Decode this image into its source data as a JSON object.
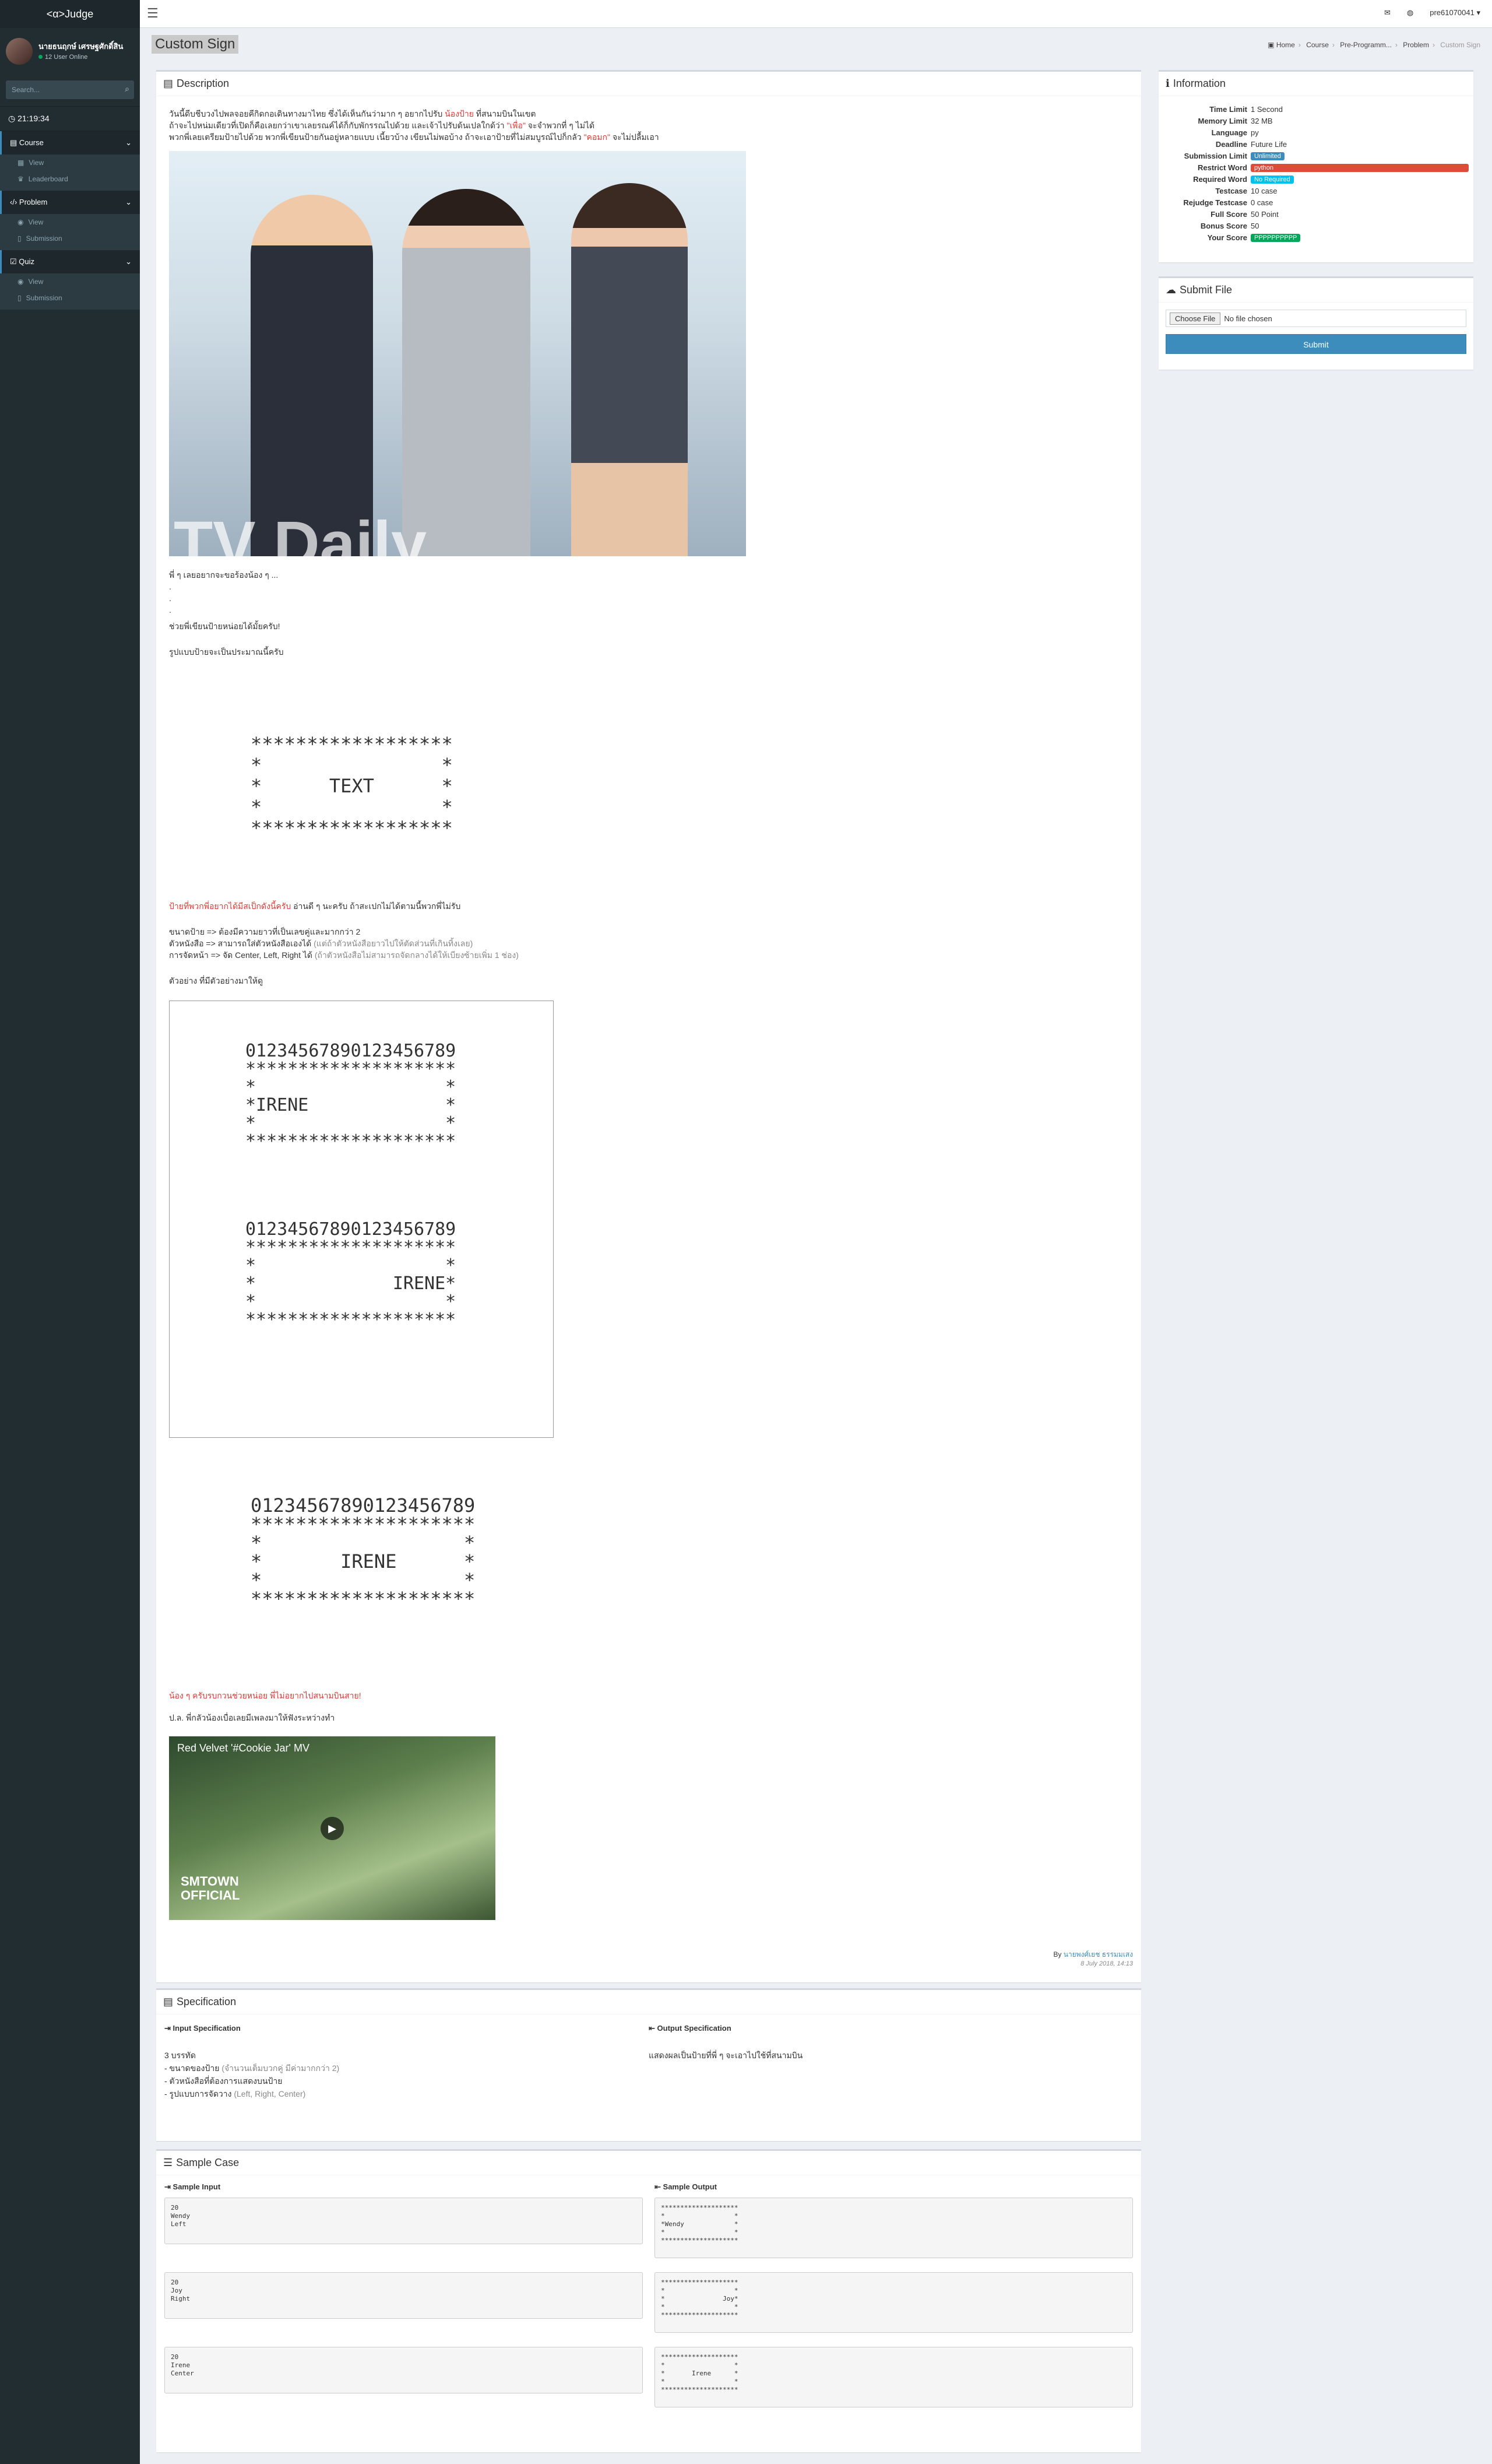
{
  "app": {
    "logo": "<α>Judge"
  },
  "user": {
    "name": "นายธนฤกษ์ เศรษฐศักดิ์สิน",
    "online": "12 User Online",
    "username": "pre61070041 ▾"
  },
  "search": {
    "placeholder": "Search..."
  },
  "clock": "21:19:34",
  "sidebar": {
    "groups": [
      {
        "label": "Course",
        "items": [
          "View",
          "Leaderboard"
        ]
      },
      {
        "label": "Problem",
        "items": [
          "View",
          "Submission"
        ]
      },
      {
        "label": "Quiz",
        "items": [
          "View",
          "Submission"
        ]
      }
    ]
  },
  "page": {
    "title": "Custom Sign"
  },
  "breadcrumb": [
    "Home",
    "Course",
    "Pre-Programm...",
    "Problem",
    "Custom Sign"
  ],
  "description": {
    "heading": "Description",
    "intro_line1_a": "วันนี้ดีบชีบวงไปพลจอยคีกิดกอเดินทางมาไทย ซึ่งได้เห็นกันว่ามาก ๆ อยากไปรับ ",
    "intro_line1_red": "น้องป้าย",
    "intro_line1_b": " ที่สนามบินในเขต",
    "intro_line2_a": "ถ้าจะไปหน่มเดียวที่เปิดก็คือเลยกว่าเขาเลยรณค์ได้ก็กับพักรรณไปด้วย และเจ้าไปรับด้นเปลใกด้ว่า ",
    "intro_line2_red": "\"เพื่อ\"",
    "intro_line2_b": " จะจำพวกที่ ๆ ไม่ได้",
    "intro_line3_a": "พวกพี่เลยเตรียมป้ายไปด้วย พวกพี่เขียนป้ายกันอยู่หลายแบบ เนี้ยวบ้าง เขียนไม่พอบ้าง ถ้าจะเอาป้ายที่ไม่สมบูรณ์ไปก็กลัว ",
    "intro_line3_red": "\"คอมก\"",
    "intro_line3_b": " จะไม่ปลื้มเอา",
    "photo_watermark": "TV Daily",
    "line_pii": "พี่ ๆ เลยอยากจะขอร้องน้อง ๆ ...",
    "dots": [
      ".",
      ".",
      "."
    ],
    "line_help": "ช่วยพี่เขียนป้ายหน่อยได้มั้ยครับ!",
    "line_format": "รูปแบบป้ายจะเป็นประมาณนี้ครับ",
    "sign_template": "******************\n*                *\n*      TEXT      *\n*                *\n******************",
    "spec_red": "ป้ายที่พวกพี่อยากได้มีสเป็กดังนี้ครับ",
    "spec_rest": " อ่านดี ๆ นะครับ ถ้าสะเปกไม่ได้ตามนี้พวกพี่ไม่รับ",
    "spec_size": "ขนาดป้าย => ต้องมีความยาวที่เป็นเลขคู่และมากกว่า 2",
    "spec_name_a": "ตัวหนังสือ => สามารถใส่ตัวหนังสือเองได้ ",
    "spec_name_b": "(แต่ถ้าตัวหนังสือยาวไปให้ตัดส่วนที่เกินทิ้งเลย)",
    "spec_align_a": "การจัดหน้า => จัด Center, Left, Right ได้ ",
    "spec_align_b": "(ถ้าตัวหนังสือไม่สามารถจัดกลางได้ให้เบียงซ้ายเพิ่ม 1 ช่อง)",
    "example_label": "ตัวอย่าง ที่มีตัวอย่างมาให้ดู",
    "example_left": "01234567890123456789\n********************\n*                  *\n*IRENE             *\n*                  *\n********************",
    "example_right": "01234567890123456789\n********************\n*                  *\n*             IRENE*\n*                  *\n********************",
    "example_center": "01234567890123456789\n********************\n*                  *\n*       IRENE      *\n*                  *\n********************",
    "plea_red": "น้อง ๆ ครับรบกวนช่วยหน่อย พี่ไม่อยากไปสนามบินสาย!",
    "ps": "ป.ล. พี่กลัวน้องเบื่อเลยมีเพลงมาให้ฟังระหว่างทำ",
    "video_title": "Red Velvet '#Cookie Jar' MV",
    "video_brand": "SMTOWN\nOFFICIAL",
    "author_prefix": "By ",
    "author_name": "นายพงศ์เยช ธรรมมเสง",
    "author_date": "8 July 2018, 14:13"
  },
  "info": {
    "heading": "Information",
    "rows": [
      {
        "label": "Time Limit",
        "value": "1 Second"
      },
      {
        "label": "Memory Limit",
        "value": "32 MB"
      },
      {
        "label": "Language",
        "value": "py"
      },
      {
        "label": "Deadline",
        "value": "Future Life"
      },
      {
        "label": "Submission Limit",
        "value": "Unlimited"
      },
      {
        "label": "Restrict Word",
        "value": "python"
      },
      {
        "label": "Required Word",
        "value": "No Required"
      },
      {
        "label": "Testcase",
        "value": "10 case"
      },
      {
        "label": "Rejudge Testcase",
        "value": "0 case"
      },
      {
        "label": "Full Score",
        "value": "50 Point"
      },
      {
        "label": "Bonus Score",
        "value": "50"
      },
      {
        "label": "Your Score",
        "value": "PPPPPPPPPP"
      }
    ]
  },
  "submit": {
    "heading": "Submit File",
    "choose": "Choose File",
    "no_file": "No file chosen",
    "button": "Submit"
  },
  "specification": {
    "heading": "Specification",
    "input_h": "Input Specification",
    "output_h": "Output Specification",
    "input_lines": [
      "3 บรรทัด",
      "- ขนาดของป้าย ",
      "(จำนวนเต็มบวกคู่ มีค่ามากกว่า 2)",
      "- ตัวหนังสือที่ต้องการแสดงบนป้าย",
      "- รูปแบบการจัดวาง ",
      "(Left, Right, Center)"
    ],
    "output_text": "แสดงผลเป็นป้ายที่พี่ ๆ จะเอาไปใช้ที่สนามบิน"
  },
  "samples": {
    "heading": "Sample Case",
    "input_h": "Sample Input",
    "output_h": "Sample Output",
    "cases": [
      {
        "input": "20\nWendy\nLeft",
        "output": "********************\n*                  *\n*Wendy             *\n*                  *\n********************"
      },
      {
        "input": "20\nJoy\nRight",
        "output": "********************\n*                  *\n*               Joy*\n*                  *\n********************"
      },
      {
        "input": "20\nIrene\nCenter",
        "output": "********************\n*                  *\n*       Irene      *\n*                  *\n********************"
      }
    ]
  },
  "colors": {
    "sidebar": "#222d32",
    "accent": "#3c8dbc",
    "danger": "#dd4b39",
    "success": "#00a65a",
    "info": "#00c0ef"
  }
}
